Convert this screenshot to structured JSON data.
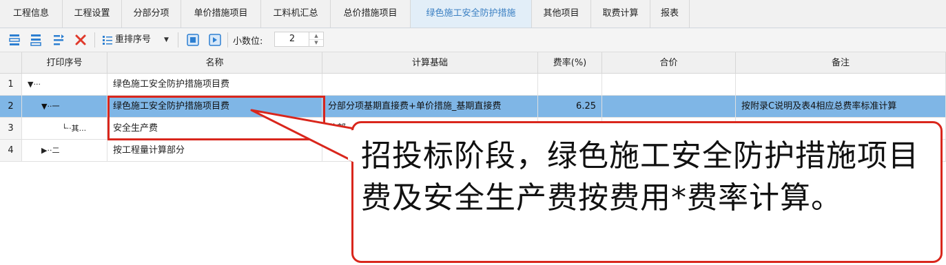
{
  "tabs": [
    {
      "label": "工程信息"
    },
    {
      "label": "工程设置"
    },
    {
      "label": "分部分项"
    },
    {
      "label": "单价措施项目"
    },
    {
      "label": "工料机汇总"
    },
    {
      "label": "总价措施项目"
    },
    {
      "label": "绿色施工安全防护措施",
      "active": true
    },
    {
      "label": "其他项目"
    },
    {
      "label": "取费计算"
    },
    {
      "label": "报表"
    }
  ],
  "toolbar": {
    "reorder_label": "重排序号",
    "decimal_label": "小数位:",
    "decimal_value": "2"
  },
  "columns": {
    "print_no": "打印序号",
    "name": "名称",
    "basis": "计算基础",
    "rate": "费率(%)",
    "total": "合价",
    "note": "备注"
  },
  "rows": [
    {
      "num": "1",
      "tree": "▼···",
      "name": "绿色施工安全防护措施项目费",
      "basis": "",
      "rate": "",
      "total": "",
      "note": ""
    },
    {
      "num": "2",
      "tree": "▼··一",
      "name": "绿色施工安全防护措施项目费",
      "basis": "分部分项基期直接费+单价措施_基期直接费",
      "rate": "6.25",
      "total": "",
      "note": "按附录C说明及表4相应总费率标准计算"
    },
    {
      "num": "3",
      "tree": "└··其...",
      "name": "安全生产费",
      "basis": "分部",
      "rate": "",
      "total": "",
      "note": ""
    },
    {
      "num": "4",
      "tree": "▶··二",
      "name": "按工程量计算部分",
      "basis": "",
      "rate": "",
      "total": "",
      "note": ""
    }
  ],
  "callout": {
    "text": "招投标阶段，绿色施工安全防护措施项目费及安全生产费按费用*费率计算。"
  },
  "colors": {
    "accent": "#3a7fc2",
    "selection": "#7fb6e6",
    "annotation": "#d9261c"
  }
}
